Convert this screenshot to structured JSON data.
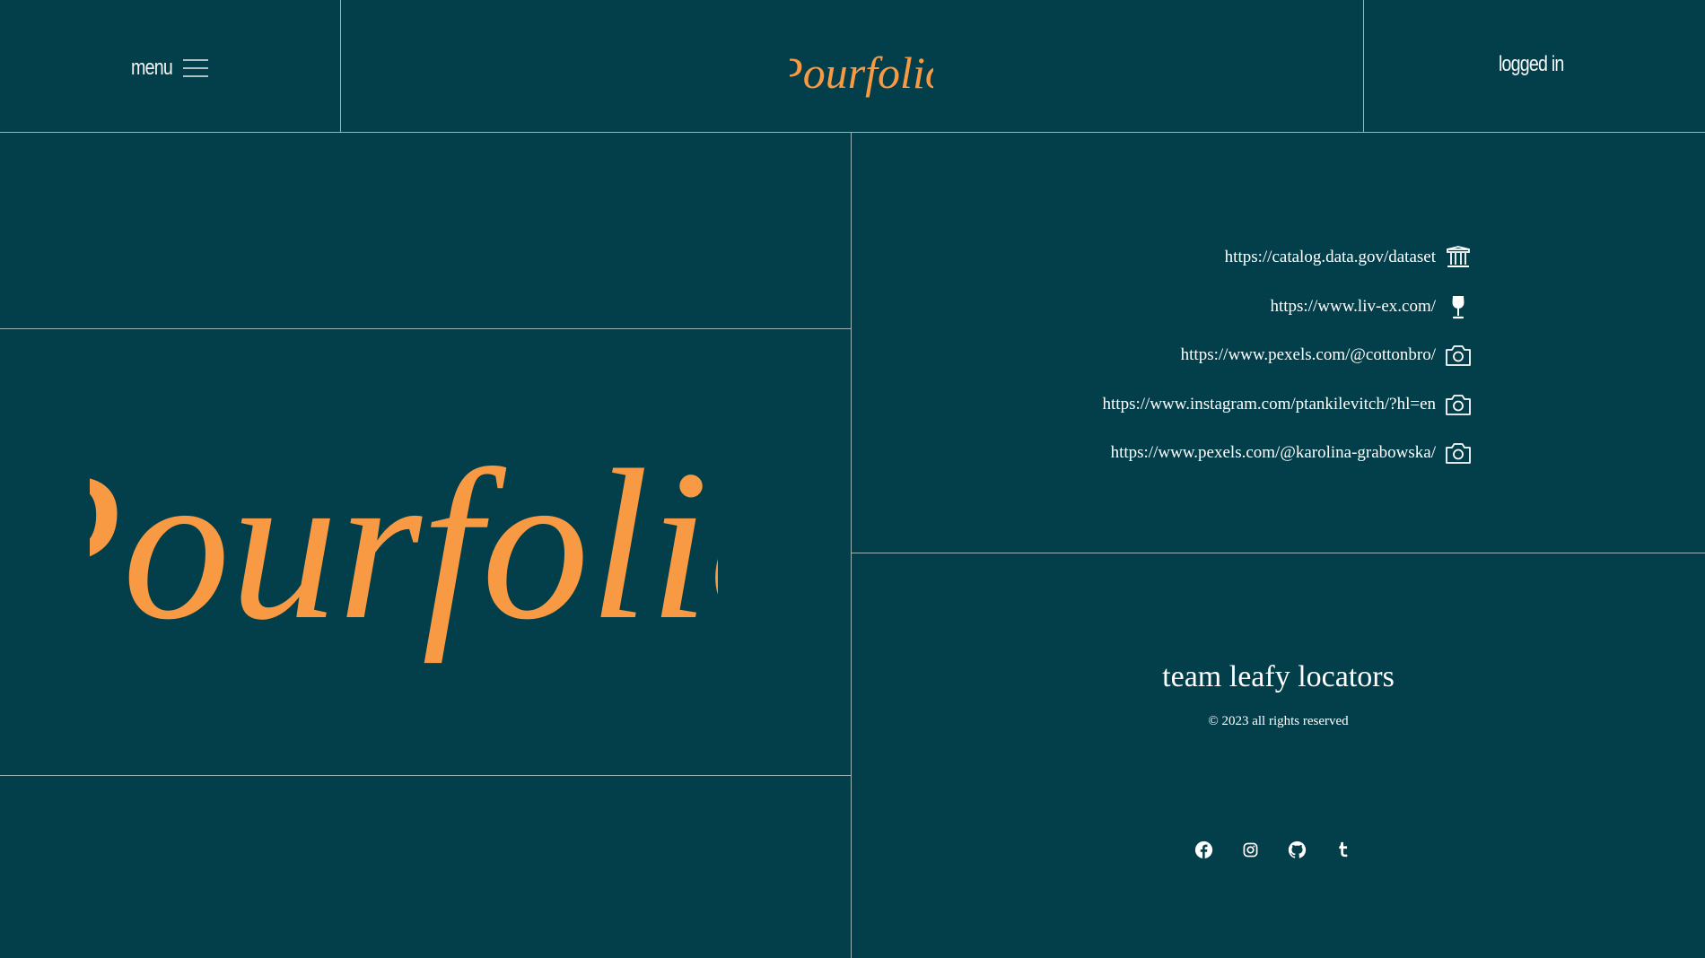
{
  "header": {
    "menu_label": "menu",
    "logo_text": "Pourfolio",
    "login_label": "logged in"
  },
  "hero": {
    "logo_text": "Pourfolio"
  },
  "sources": [
    {
      "url": "https://catalog.data.gov/dataset",
      "icon": "bank-icon"
    },
    {
      "url": "https://www.liv-ex.com/",
      "icon": "wine-glass-icon"
    },
    {
      "url": "https://www.pexels.com/@cottonbro/",
      "icon": "camera-icon"
    },
    {
      "url": "https://www.instagram.com/ptankilevitch/?hl=en",
      "icon": "camera-icon"
    },
    {
      "url": "https://www.pexels.com/@karolina-grabowska/",
      "icon": "camera-icon"
    }
  ],
  "footer": {
    "team_name": "team leafy locators",
    "copyright": "© 2023 all rights reserved",
    "socials": [
      "facebook-icon",
      "instagram-icon",
      "github-icon",
      "tumblr-icon"
    ]
  },
  "colors": {
    "background": "#023F4B",
    "accent": "#F89A43",
    "text": "#FFFFFF",
    "divider": "#9FB4B8"
  }
}
